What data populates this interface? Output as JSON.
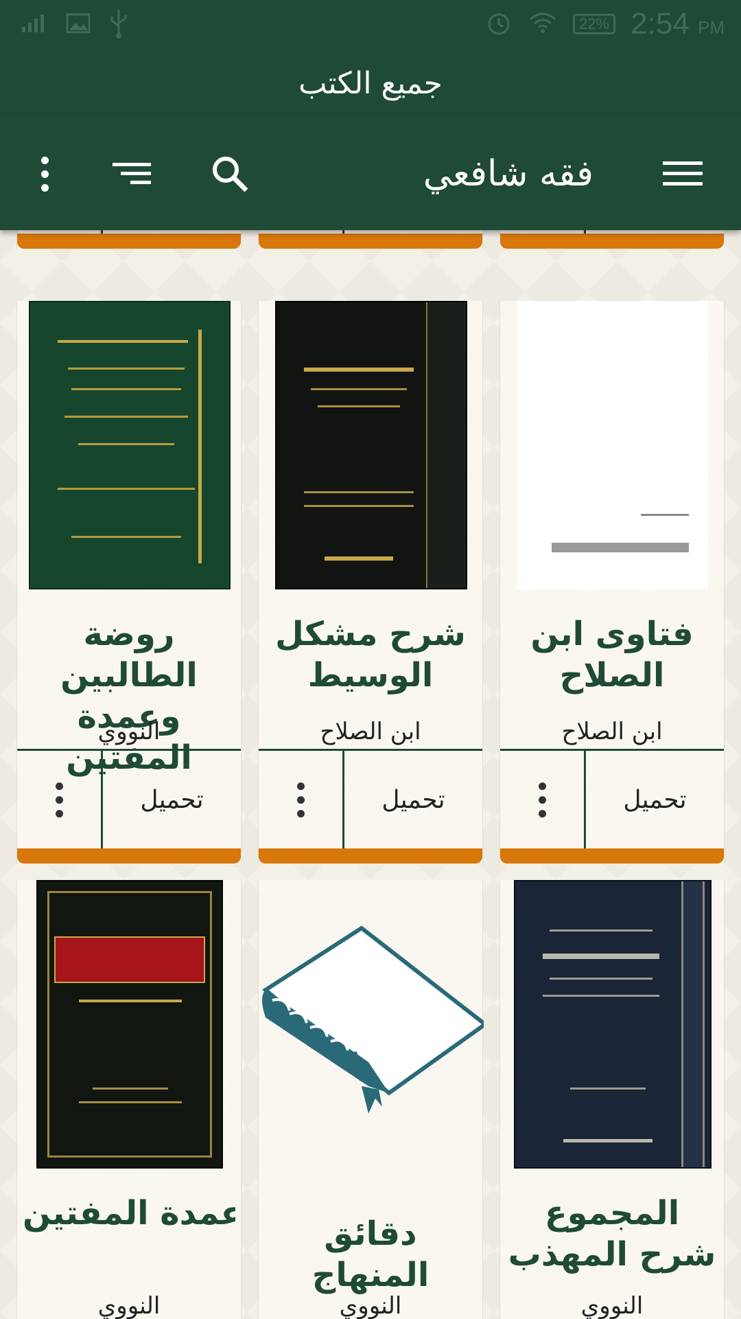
{
  "status_bar": {
    "time": "2:54",
    "ampm": "PM",
    "battery": "22%",
    "icons": [
      "signal-icon",
      "image-icon",
      "usb-icon",
      "alarm-icon",
      "wifi-icon",
      "battery-icon"
    ]
  },
  "header": {
    "title": "جميع الكتب"
  },
  "toolbar": {
    "category_title": "فقه شافعي",
    "icons": [
      "hamburger-menu-icon",
      "search-icon",
      "sort-icon",
      "more-vert-icon"
    ]
  },
  "colors": {
    "primary": "#1f4a36",
    "accent": "#d8770a",
    "background": "#f2efe6"
  },
  "books": [
    {
      "title": "روضة الطالبين وعمدة المفتين",
      "author": "النووي",
      "download_label": "تحميل",
      "cover": "green-cover"
    },
    {
      "title": "شرح مشكل الوسيط",
      "author": "ابن الصلاح",
      "download_label": "تحميل",
      "cover": "black-cover"
    },
    {
      "title": "فتاوى ابن الصلاح",
      "author": "ابن الصلاح",
      "download_label": "تحميل",
      "cover": "white-cover"
    },
    {
      "title": "منهاج الطالبين وعمدة المفتين...",
      "author": "النووي",
      "download_label": "",
      "cover": "black-red-cover"
    },
    {
      "title": "دقائق المنهاج",
      "author": "النووي",
      "download_label": "",
      "cover": "book-placeholder-icon"
    },
    {
      "title": "المجموع شرح المهذب",
      "author": "النووي",
      "download_label": "",
      "cover": "navy-cover"
    }
  ]
}
